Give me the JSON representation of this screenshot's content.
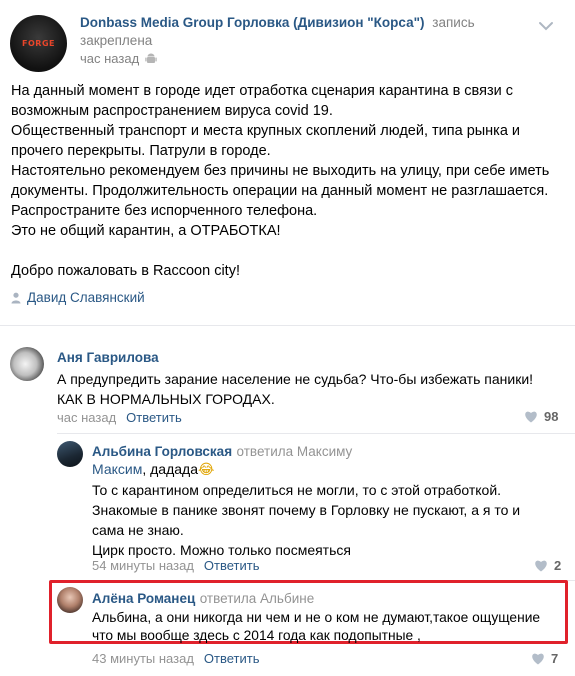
{
  "post": {
    "group_name": "Donbass Media Group Горловка (Дивизион \"Корса\")",
    "pinned_note_1": "запись",
    "pinned_note_2": "закреплена",
    "time": "час назад",
    "lines": [
      "На данный момент в городе идет отработка сценария карантина в связи с",
      "возможным распространением вируса covid 19.",
      "Общественный транспорт и места крупных скоплений людей, типа рынка и",
      "прочего перекрыты. Патрули в городе.",
      "Настоятельно рекомендуем без причины не выходить на улицу, при себе иметь",
      "документы. Продолжительность операции на данный момент не разглашается.",
      "Распространите без испорченного телефона.",
      "Это не общий карантин, а ОТРАБОТКА!",
      "",
      "Добро пожаловать в Raccoon city!"
    ],
    "author": "Давид Славянский",
    "avatar_text": "FORGE"
  },
  "comments": [
    {
      "name": "Аня Гаврилова",
      "replied_to": "",
      "lines": [
        "А предупредить зарание население не судьба? Что-бы избежать паники!",
        "КАК В НОРМАЛЬНЫХ ГОРОДАХ."
      ],
      "time": "час назад",
      "reply_label": "Ответить",
      "likes": "98"
    },
    {
      "name": "Альбина Горловская",
      "replied_to": "ответила Максиму",
      "mention": "Максим",
      "mention_tail": ", дадада",
      "emoji": "😂",
      "lines": [
        "То с карантином определиться не могли, то с этой отработкой.",
        "Знакомые в панике звонят почему в Горловку не пускают, а я то и",
        "сама не знаю.",
        "Цирк просто. Можно только посмеяться"
      ],
      "time": "54 минуты назад",
      "reply_label": "Ответить",
      "likes": "2"
    },
    {
      "name": "Алёна Романец",
      "replied_to": "ответила Альбине",
      "lines": [
        "Альбина, а они никогда ни чем и не о ком не думают,такое ощущение",
        "что мы вообще здесь с 2014 года как подопытные ,"
      ],
      "time": "43 минуты назад",
      "reply_label": "Ответить",
      "likes": "7"
    }
  ],
  "colors": {
    "link": "#2a5885",
    "meta": "#939393",
    "highlight_border": "#e0212b"
  }
}
